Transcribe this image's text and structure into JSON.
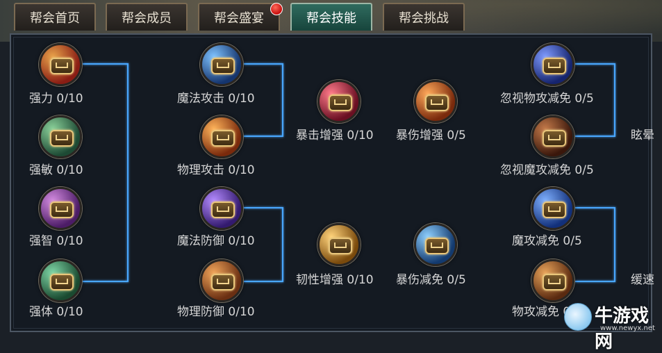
{
  "tabs": [
    {
      "label": "帮会首页",
      "active": false,
      "badge": false
    },
    {
      "label": "帮会成员",
      "active": false,
      "badge": false
    },
    {
      "label": "帮会盛宴",
      "active": false,
      "badge": true
    },
    {
      "label": "帮会技能",
      "active": true,
      "badge": false
    },
    {
      "label": "帮会挑战",
      "active": false,
      "badge": false
    }
  ],
  "skills": {
    "col1": [
      {
        "label": "强力  0/10",
        "icon": "strength-icon",
        "color": "#c0392b"
      },
      {
        "label": "强敏  0/10",
        "icon": "agility-icon",
        "color": "#2f7a55"
      },
      {
        "label": "强智  0/10",
        "icon": "intellect-icon",
        "color": "#8e3fb0"
      },
      {
        "label": "强体  0/10",
        "icon": "stamina-icon",
        "color": "#2f8a5a"
      }
    ],
    "col2": [
      {
        "label": "魔法攻击  0/10",
        "icon": "magic-attack-icon",
        "color": "#2b6cc4"
      },
      {
        "label": "物理攻击  0/10",
        "icon": "physical-attack-icon",
        "color": "#c0561b"
      },
      {
        "label": "魔法防御  0/10",
        "icon": "magic-defense-icon",
        "color": "#6a3bb5"
      },
      {
        "label": "物理防御  0/10",
        "icon": "physical-defense-icon",
        "color": "#b6611e"
      }
    ],
    "col3": [
      {
        "label": "暴击增强  0/10",
        "icon": "crit-boost-icon",
        "color": "#b0283a"
      },
      {
        "label": "韧性增强  0/10",
        "icon": "toughness-boost-icon",
        "color": "#c47c1c"
      }
    ],
    "col4": [
      {
        "label": "暴伤增强  0/5",
        "icon": "crit-damage-boost-icon",
        "color": "#d35a1c"
      },
      {
        "label": "暴伤减免  0/5",
        "icon": "crit-damage-reduce-icon",
        "color": "#1f6fb5"
      }
    ],
    "col5": [
      {
        "label": "忽视物攻减免  0/5",
        "icon": "ignore-physical-reduce-icon",
        "color": "#2a4fa8"
      },
      {
        "label": "忽视魔攻减免  0/5",
        "icon": "ignore-magic-reduce-icon",
        "color": "#5a2f1c"
      },
      {
        "label": "魔攻减免  0/5",
        "icon": "magic-reduce-icon",
        "color": "#1d4fb0"
      },
      {
        "label": "物攻减免  0/5",
        "icon": "physical-reduce-icon",
        "color": "#a05a22"
      }
    ],
    "tail": [
      "眩晕",
      "缓速"
    ]
  },
  "watermark": {
    "name": "牛游戏网",
    "url": "www.newyx.net"
  }
}
